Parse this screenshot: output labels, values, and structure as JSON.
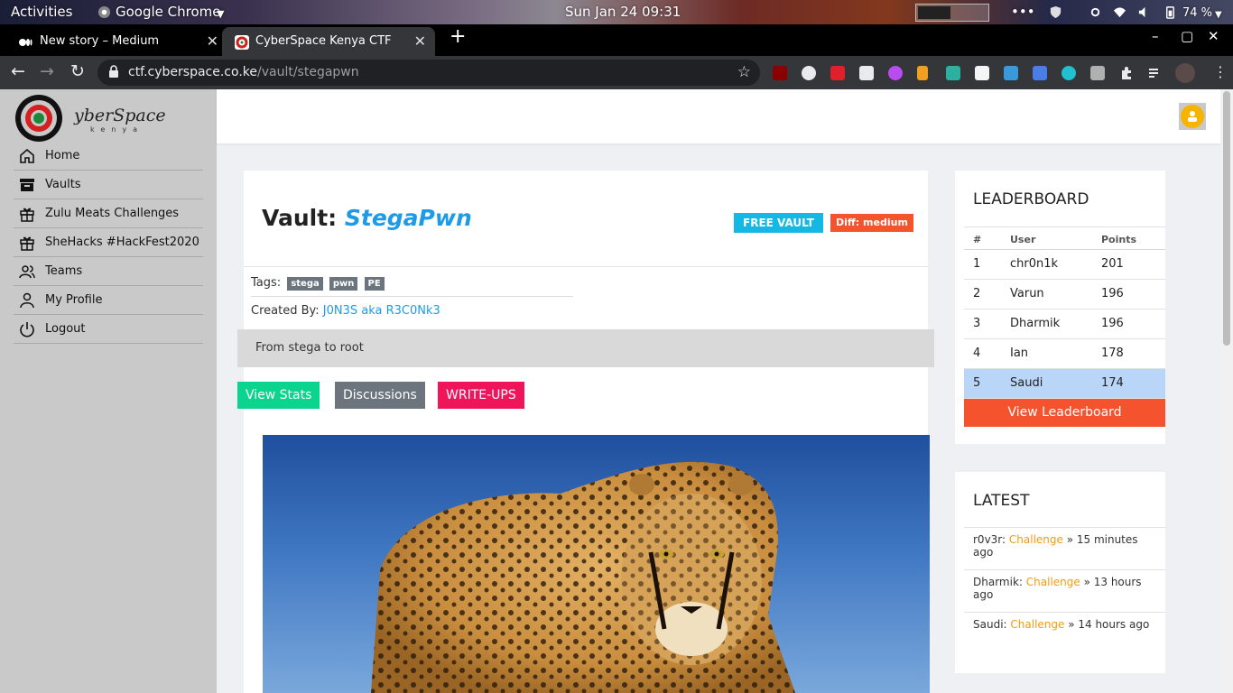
{
  "system": {
    "activities": "Activities",
    "app_name": "Google Chrome",
    "clock": "Sun Jan 24  09:31",
    "battery": "74 %"
  },
  "tabs": [
    {
      "title": "New story – Medium",
      "close": "✕"
    },
    {
      "title": "CyberSpace Kenya CTF",
      "close": "✕"
    }
  ],
  "new_tab": "+",
  "window_controls": {
    "minimize": "–",
    "maximize": "▢",
    "close": "✕"
  },
  "address_bar": {
    "host": "ctf.cyberspace.co.ke",
    "path": "/vault/stegapwn"
  },
  "nav_icons": {
    "back": "←",
    "forward": "→",
    "reload": "↻",
    "star": "☆"
  },
  "logo": {
    "text": "yberSpace",
    "sub": "kenya"
  },
  "sidebar": {
    "items": [
      {
        "label": "Home",
        "icon": "home-icon"
      },
      {
        "label": "Vaults",
        "icon": "archive-icon"
      },
      {
        "label": "Zulu Meats Challenges",
        "icon": "gift-icon"
      },
      {
        "label": "SheHacks #HackFest2020",
        "icon": "gift-icon"
      },
      {
        "label": "Teams",
        "icon": "users-icon"
      },
      {
        "label": "My Profile",
        "icon": "user-icon"
      },
      {
        "label": "Logout",
        "icon": "power-icon"
      }
    ]
  },
  "vault": {
    "prefix": "Vault: ",
    "name": "StegaPwn",
    "free_badge": "FREE VAULT",
    "diff_badge": "Diff: medium",
    "tags_label": "Tags:",
    "tags": [
      "stega",
      "pwn",
      "PE"
    ],
    "created_label": "Created By: ",
    "author": "J0N3S aka R3C0Nk3",
    "description": "From stega to root",
    "buttons": {
      "stats": "View Stats",
      "discussions": "Discussions",
      "writeups": "WRITE-UPS"
    }
  },
  "leaderboard": {
    "title": "LEADERBOARD",
    "headers": [
      "#",
      "User",
      "Points"
    ],
    "rows": [
      {
        "rank": "1",
        "user": "chr0n1k",
        "points": "201"
      },
      {
        "rank": "2",
        "user": "Varun",
        "points": "196"
      },
      {
        "rank": "3",
        "user": "Dharmik",
        "points": "196"
      },
      {
        "rank": "4",
        "user": "Ian",
        "points": "178"
      },
      {
        "rank": "5",
        "user": "Saudi",
        "points": "174"
      }
    ],
    "button": "View Leaderboard"
  },
  "latest": {
    "title": "LATEST",
    "items": [
      {
        "user": "r0v3r: ",
        "link": "Challenge",
        "time": " » 15 minutes ago"
      },
      {
        "user": "Dharmik: ",
        "link": "Challenge",
        "time": " » 13 hours ago"
      },
      {
        "user": "Saudi: ",
        "link": "Challenge",
        "time": " » 14 hours ago"
      }
    ]
  },
  "colors": {
    "accent_blue": "#1e9be6",
    "free_badge": "#15b8e3",
    "diff_badge": "#f4532e",
    "stats_button": "#0bd48f",
    "writeups_button": "#f0145a",
    "highlight_row": "#b9d5f7",
    "link_orange": "#f39c12"
  }
}
